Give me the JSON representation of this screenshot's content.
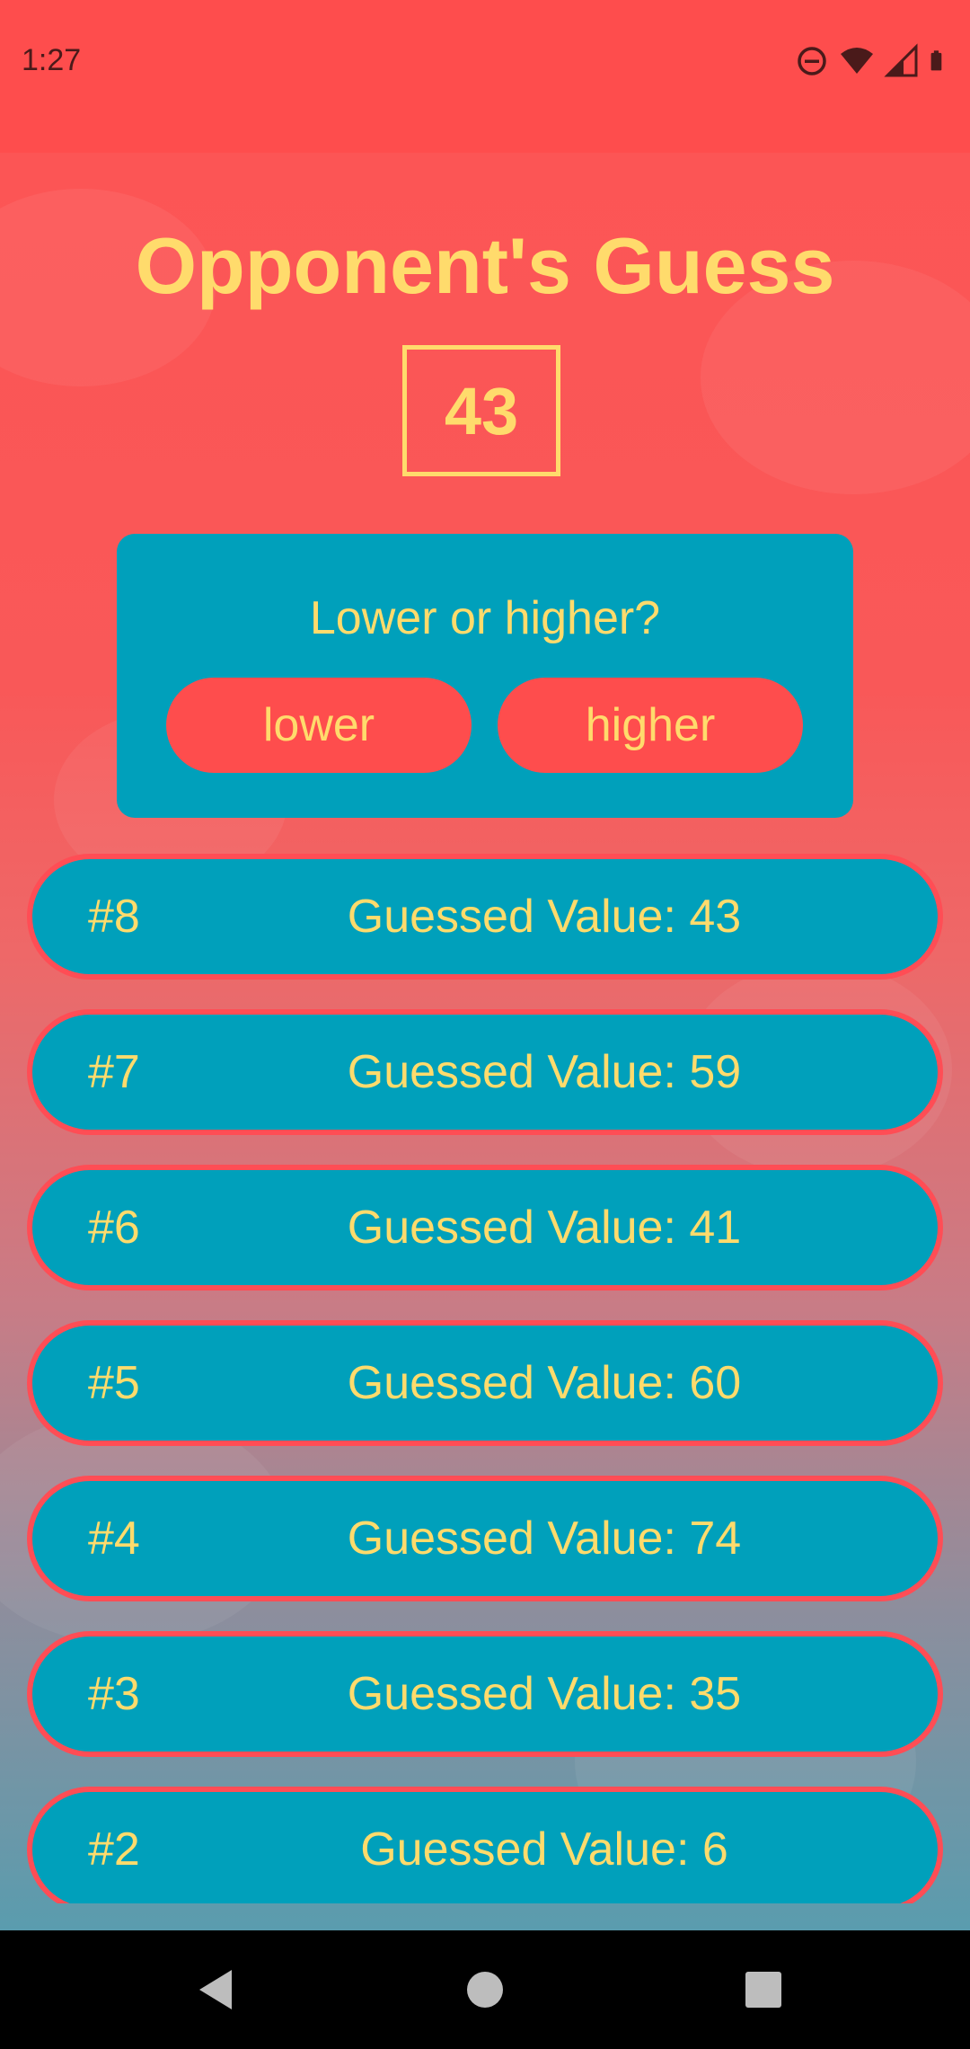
{
  "status_bar": {
    "time": "1:27",
    "icons": [
      "do-not-disturb-icon",
      "wifi-icon",
      "cell-signal-icon",
      "battery-icon"
    ]
  },
  "screen": {
    "title": "Opponent's Guess",
    "current_guess": "43"
  },
  "prompt_card": {
    "question": "Lower or higher?",
    "lower_label": "lower",
    "higher_label": "higher"
  },
  "guesses": [
    {
      "num": "#8",
      "label": "Guessed Value: 43"
    },
    {
      "num": "#7",
      "label": "Guessed Value: 59"
    },
    {
      "num": "#6",
      "label": "Guessed Value: 41"
    },
    {
      "num": "#5",
      "label": "Guessed Value: 60"
    },
    {
      "num": "#4",
      "label": "Guessed Value: 74"
    },
    {
      "num": "#3",
      "label": "Guessed Value: 35"
    },
    {
      "num": "#2",
      "label": "Guessed Value: 6"
    }
  ],
  "nav": {
    "icons": [
      "back-icon",
      "home-icon",
      "recents-icon"
    ]
  },
  "colors": {
    "status_bar": "#fe4d4d",
    "accent_yellow": "#ffdb6c",
    "card_teal": "#00a0bb",
    "button_red": "#fe4d4d",
    "row_border": "#ff4d55"
  }
}
